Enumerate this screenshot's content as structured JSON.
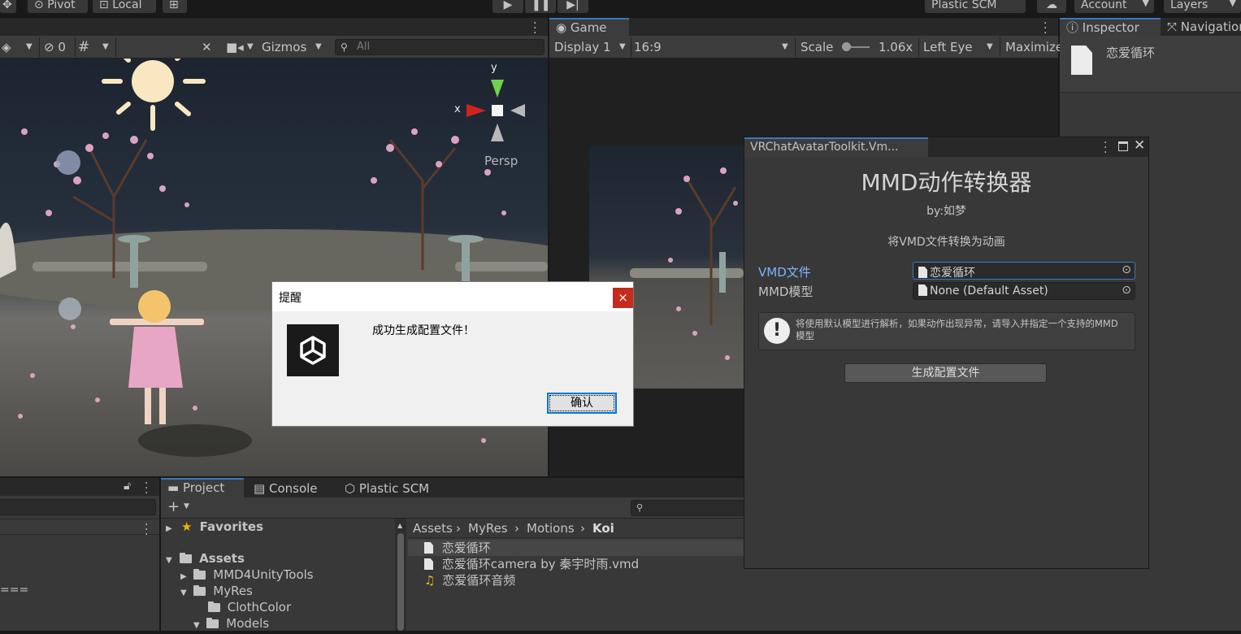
{
  "toolbar": {
    "pivot": "Pivot",
    "local": "Local",
    "plastic": "Plastic SCM",
    "account": "Account",
    "layers": "Layers"
  },
  "scene": {
    "hidden_count": "0",
    "gizmos": "Gizmos",
    "search_placeholder": "All",
    "axis_x": "x",
    "axis_y": "y",
    "persp": "Persp"
  },
  "game": {
    "tab": "Game",
    "display": "Display 1",
    "aspect": "16:9",
    "scale_label": "Scale",
    "scale_value": "1.06x",
    "eye": "Left Eye",
    "maximize": "Maximize"
  },
  "inspector": {
    "tab": "Inspector",
    "nav_tab": "Navigation",
    "asset_name": "恋爱循环"
  },
  "converter": {
    "window_title": "VRChatAvatarToolkit.Vm...",
    "heading": "MMD动作转换器",
    "author": "by:如梦",
    "subtitle": "将VMD文件转换为动画",
    "vmd_label": "VMD文件",
    "vmd_value": "恋爱循环",
    "model_label": "MMD模型",
    "model_value": "None (Default Asset)",
    "warning": "将使用默认模型进行解析，如果动作出现异常，请导入并指定一个支持的MMD模型",
    "generate_button": "生成配置文件"
  },
  "dialog": {
    "title": "提醒",
    "message": "成功生成配置文件！",
    "confirm": "确认",
    "close": "×"
  },
  "hierarchy": {
    "fragment": "==="
  },
  "project": {
    "tabs": [
      "Project",
      "Console",
      "Plastic SCM"
    ],
    "favorites": "Favorites",
    "tree": [
      "Assets",
      "MMD4UnityTools",
      "MyRes",
      "ClothColor",
      "Models"
    ],
    "breadcrumb": [
      "Assets",
      "MyRes",
      "Motions",
      "Koi"
    ],
    "files": [
      "恋爱循环",
      "恋爱循环camera by 秦宇时雨.vmd",
      "恋爱循环音频"
    ]
  }
}
